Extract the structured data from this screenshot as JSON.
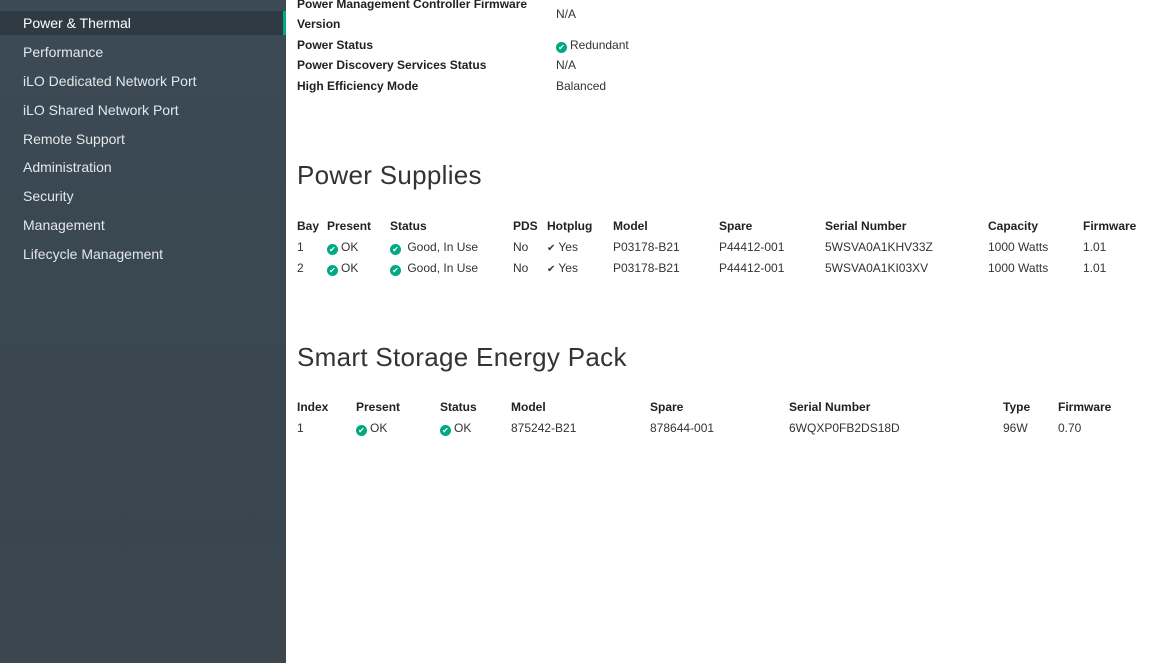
{
  "sidebar": {
    "items": [
      {
        "label": "Power & Thermal",
        "active": true
      },
      {
        "label": "Performance"
      },
      {
        "label": "iLO Dedicated Network Port"
      },
      {
        "label": "iLO Shared Network Port"
      },
      {
        "label": "Remote Support"
      },
      {
        "label": "Administration"
      },
      {
        "label": "Security"
      },
      {
        "label": "Management"
      },
      {
        "label": "Lifecycle Management"
      }
    ]
  },
  "summary": {
    "firmware_label_line1": "Power Management Controller Firmware",
    "firmware_label_line2": "Version",
    "firmware_value": "N/A",
    "power_status_label": "Power Status",
    "power_status_value": "Redundant",
    "discovery_label": "Power Discovery Services Status",
    "discovery_value": "N/A",
    "efficiency_label": "High Efficiency Mode",
    "efficiency_value": "Balanced"
  },
  "power_supplies": {
    "title": "Power Supplies",
    "headers": [
      "Bay",
      "Present",
      "Status",
      "PDS",
      "Hotplug",
      "Model",
      "Spare",
      "Serial Number",
      "Capacity",
      "Firmware"
    ],
    "rows": [
      {
        "bay": "1",
        "present": "OK",
        "status": "Good, In Use",
        "pds": "No",
        "hotplug": "Yes",
        "model": "P03178-B21",
        "spare": "P44412-001",
        "serial": "5WSVA0A1KHV33Z",
        "capacity": "1000 Watts",
        "firmware": "1.01"
      },
      {
        "bay": "2",
        "present": "OK",
        "status": "Good, In Use",
        "pds": "No",
        "hotplug": "Yes",
        "model": "P03178-B21",
        "spare": "P44412-001",
        "serial": "5WSVA0A1KI03XV",
        "capacity": "1000 Watts",
        "firmware": "1.01"
      }
    ]
  },
  "energy_pack": {
    "title": "Smart Storage Energy Pack",
    "headers": [
      "Index",
      "Present",
      "Status",
      "Model",
      "Spare",
      "Serial Number",
      "Type",
      "Firmware"
    ],
    "rows": [
      {
        "index": "1",
        "present": "OK",
        "status": "OK",
        "model": "875242-B21",
        "spare": "878644-001",
        "serial": "6WQXP0FB2DS18D",
        "type": "96W",
        "firmware": "0.70"
      }
    ]
  },
  "colors": {
    "status_ok": "#01a982",
    "sidebar_bg": "#3b4a55",
    "accent": "#01a982"
  },
  "icons": {
    "ok": "check-circle-icon",
    "hotplug": "checkmark-icon"
  }
}
